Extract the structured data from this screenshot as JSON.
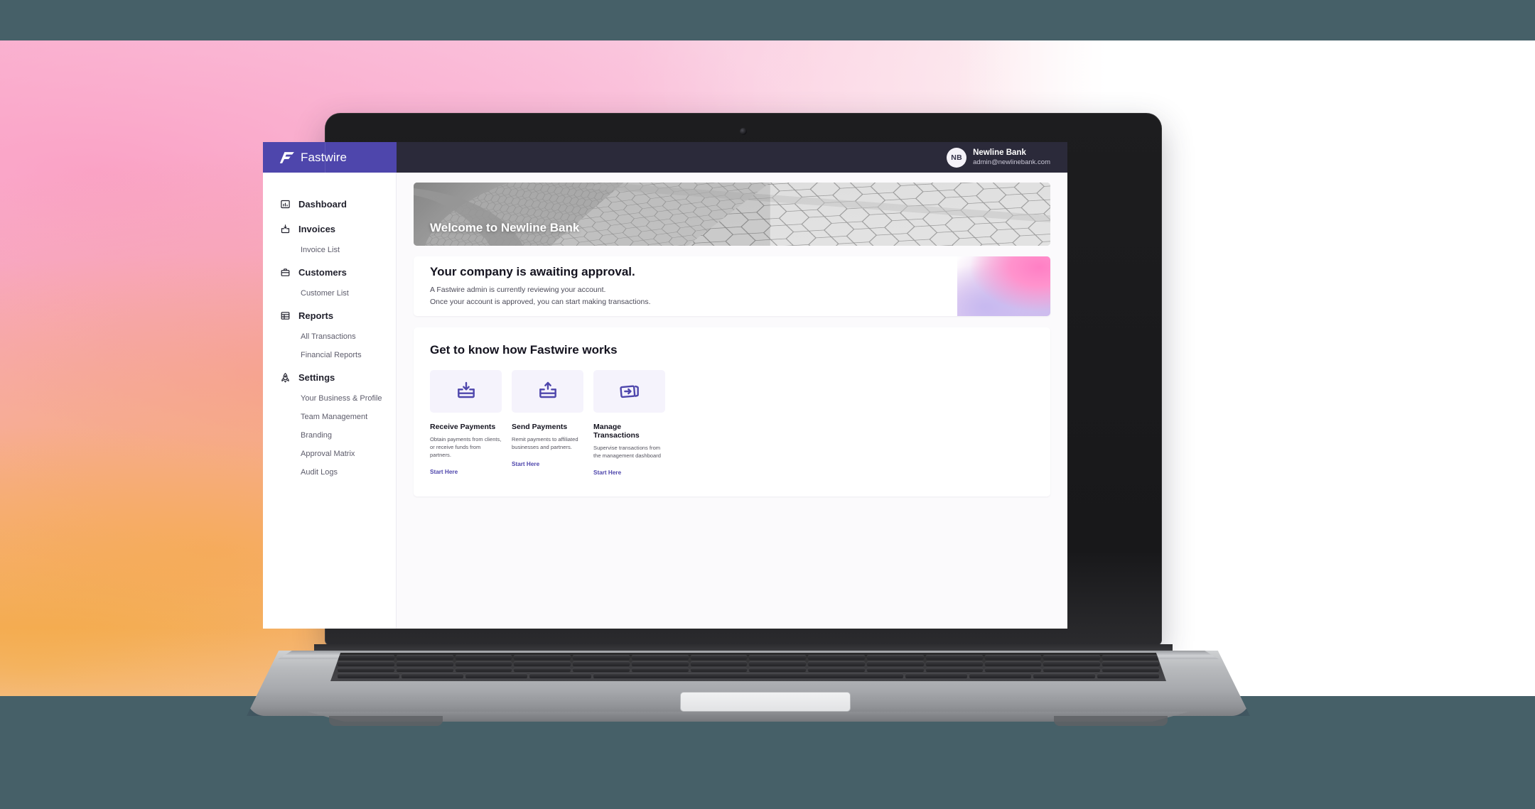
{
  "theme": {
    "brand_purple": "#4e46ac",
    "topbar_dark": "#2b2a3a",
    "page_bg": "#fbfafc",
    "scene_bar": "#466068",
    "link": "#4e46ac",
    "tile_bg": "#f5f3fc"
  },
  "topbar": {
    "brand_name": "Fastwire",
    "brand_icon": "fastwire-f-logo",
    "user": {
      "initials": "NB",
      "name": "Newline Bank",
      "email": "admin@newlinebank.com"
    }
  },
  "sidebar": {
    "groups": [
      {
        "label": "Dashboard",
        "icon": "chart-bar-icon",
        "children": []
      },
      {
        "label": "Invoices",
        "icon": "invoice-download-icon",
        "children": [
          "Invoice List"
        ]
      },
      {
        "label": "Customers",
        "icon": "briefcase-icon",
        "children": [
          "Customer List"
        ]
      },
      {
        "label": "Reports",
        "icon": "table-grid-icon",
        "children": [
          "All Transactions",
          "Financial Reports"
        ]
      },
      {
        "label": "Settings",
        "icon": "rocket-icon",
        "children": [
          "Your Business & Profile",
          "Team Management",
          "Branding",
          "Approval Matrix",
          "Audit Logs"
        ]
      }
    ]
  },
  "main": {
    "hero": {
      "title": "Welcome to Newline Bank",
      "image_desc": "grayscale-tiled-architecture-photo"
    },
    "approval": {
      "title": "Your company is awaiting approval.",
      "line1": "A Fastwire admin is currently reviewing your account.",
      "line2": "Once your account is approved, you can start making transactions.",
      "art_desc": "pink-lavender-gradient-blob"
    },
    "howto": {
      "title": "Get to know how Fastwire works",
      "features": [
        {
          "icon": "tray-download-icon",
          "name": "Receive Payments",
          "desc": "Obtain payments from clients, or receive funds from partners.",
          "link": "Start Here"
        },
        {
          "icon": "tray-upload-icon",
          "name": "Send Payments",
          "desc": "Remit payments to affiliated businesses and partners.",
          "link": "Start Here"
        },
        {
          "icon": "card-arrow-right-icon",
          "name": "Manage Transactions",
          "desc": "Supervise transactions from the management dashboard",
          "link": "Start Here"
        }
      ]
    }
  }
}
